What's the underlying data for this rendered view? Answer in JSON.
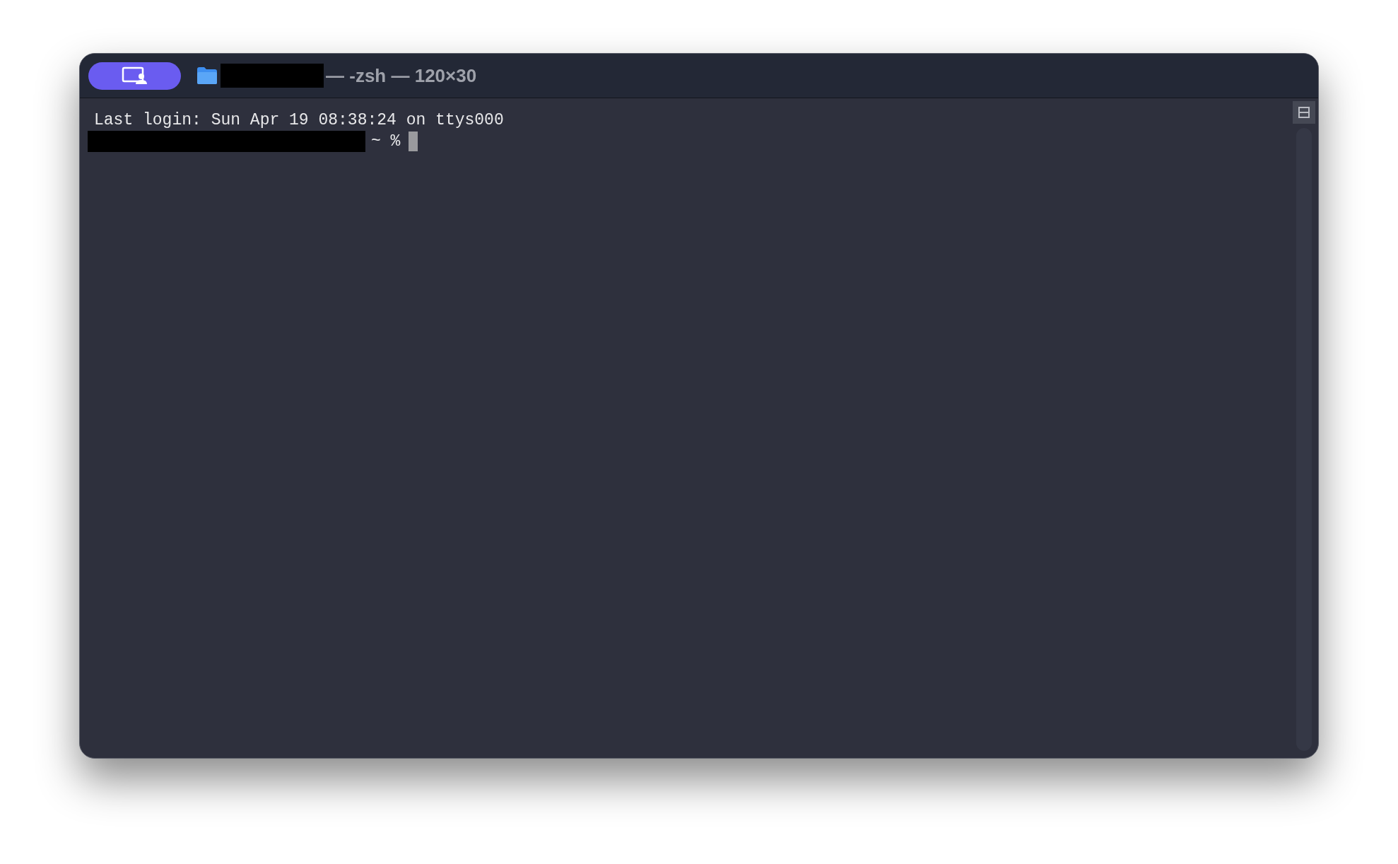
{
  "window": {
    "title": "— -zsh — 120×30"
  },
  "terminal": {
    "lines": [
      {
        "kind": "text",
        "text": "Last login: Sun Apr 19 08:38:24 on ttys000"
      },
      {
        "kind": "prompt",
        "text": "~ %"
      }
    ]
  }
}
